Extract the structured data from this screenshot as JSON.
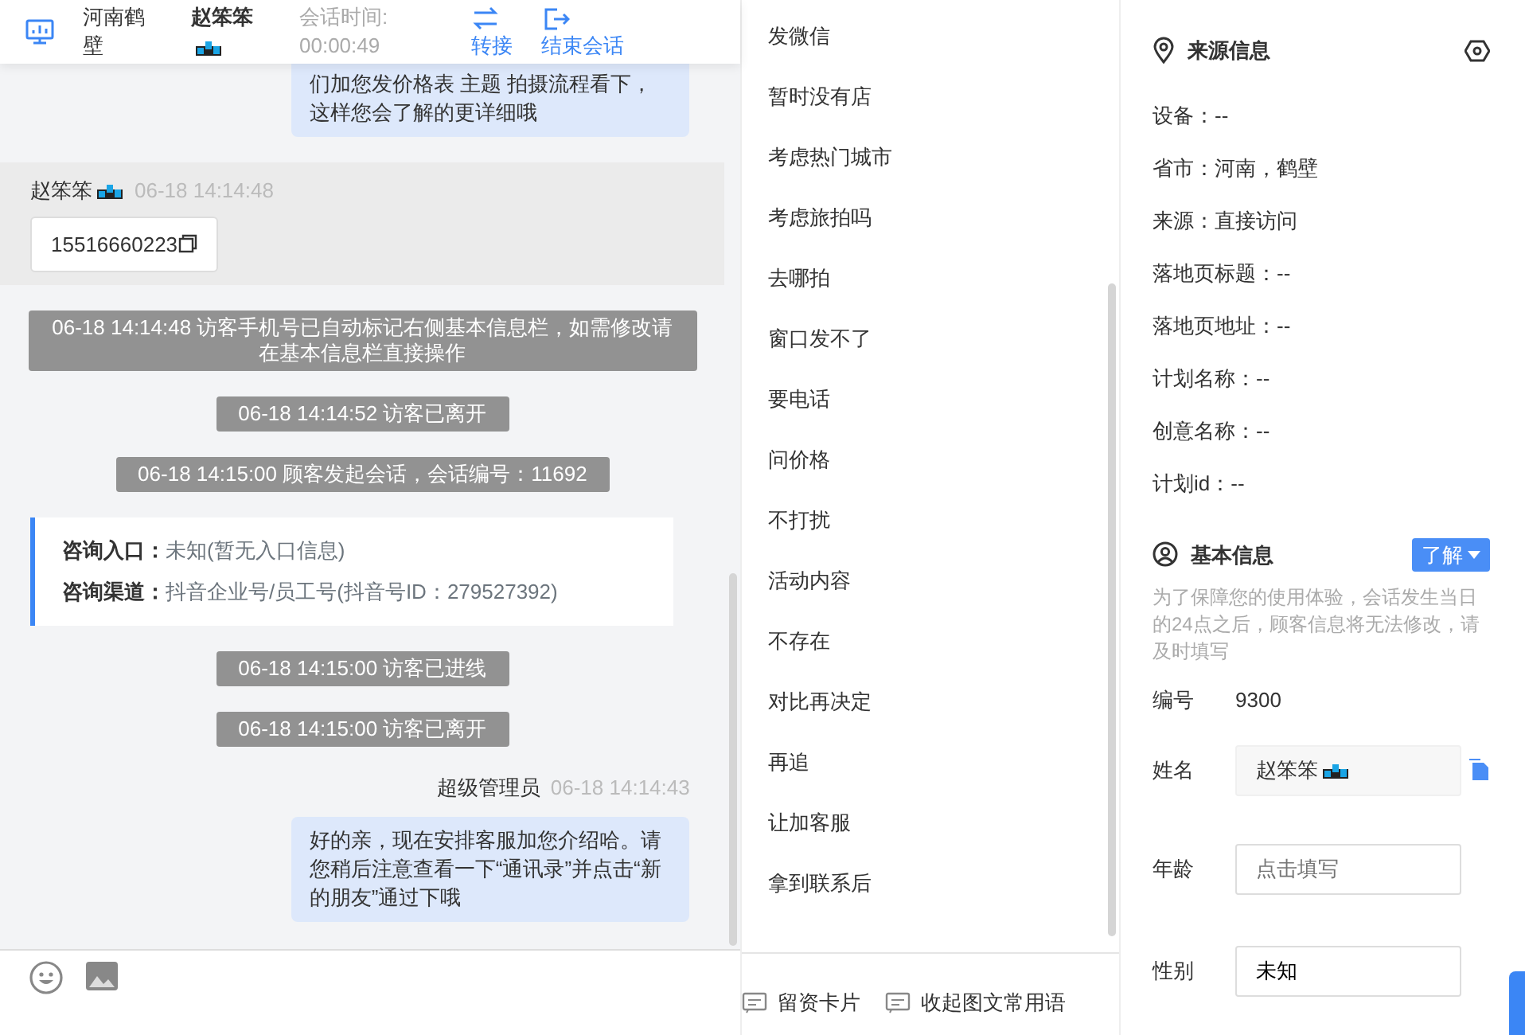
{
  "header": {
    "location": "河南鹤壁",
    "visitor": "赵笨笨",
    "timer_label": "会话时间:",
    "timer": "00:00:49",
    "actions": [
      {
        "label": "转接",
        "kind": "transfer"
      },
      {
        "label": "结束会话",
        "kind": "end"
      }
    ]
  },
  "messages": [
    {
      "kind": "agent",
      "text": "们加您发价格表 主题 拍摄流程看下，这样您会了解的更详细哦"
    },
    {
      "kind": "visitor",
      "sender": "赵笨笨",
      "time": "06-18 14:14:48",
      "text": "15516660223"
    },
    {
      "kind": "system",
      "text": "06-18 14:14:48 访客手机号已自动标记右侧基本信息栏，如需修改请在基本信息栏直接操作"
    },
    {
      "kind": "system",
      "text": "06-18 14:14:52 访客已离开"
    },
    {
      "kind": "system",
      "text": "06-18 14:15:00 顾客发起会话，会话编号：11692"
    },
    {
      "kind": "info",
      "lines": [
        {
          "label": "咨询入口：",
          "value": "未知(暂无入口信息)"
        },
        {
          "label": "咨询渠道：",
          "value": "抖音企业号/员工号(抖音号ID：279527392)"
        }
      ]
    },
    {
      "kind": "system",
      "text": "06-18 14:15:00 访客已进线"
    },
    {
      "kind": "system",
      "text": "06-18 14:15:00 访客已离开"
    },
    {
      "kind": "agent",
      "sender": "超级管理员",
      "time": "06-18 14:14:43",
      "text": "好的亲，现在安排客服加您介绍哈。请您稍后注意查看一下“通讯录”并点击“新的朋友”通过下哦"
    }
  ],
  "quick_replies": [
    "发微信",
    "暂时没有店",
    "考虑热门城市",
    "考虑旅拍吗",
    "去哪拍",
    "窗口发不了",
    "要电话",
    "问价格",
    "不打扰",
    "活动内容",
    "不存在",
    "对比再决定",
    "再追",
    "让加客服",
    "拿到联系后"
  ],
  "footer_actions": [
    {
      "label": "留资卡片"
    },
    {
      "label": "收起图文常用语"
    }
  ],
  "source_info": {
    "title": "来源信息",
    "fields": [
      "设备：--",
      "省市：河南，鹤壁",
      "来源：直接访问",
      "落地页标题：--",
      "落地页地址：--",
      "计划名称：--",
      "创意名称：--",
      "计划id：--"
    ]
  },
  "basic_info": {
    "title": "基本信息",
    "dropdown": "了解",
    "notice": "为了保障您的使用体验，会话发生当日的24点之后，顾客信息将无法修改，请及时填写",
    "fields": [
      {
        "kind": "text",
        "label": "编号",
        "value": "9300"
      },
      {
        "kind": "name",
        "label": "姓名",
        "value": "赵笨笨"
      },
      {
        "kind": "input",
        "label": "年龄",
        "placeholder": "点击填写"
      },
      {
        "kind": "input",
        "label": "性别",
        "value": "未知"
      }
    ]
  }
}
